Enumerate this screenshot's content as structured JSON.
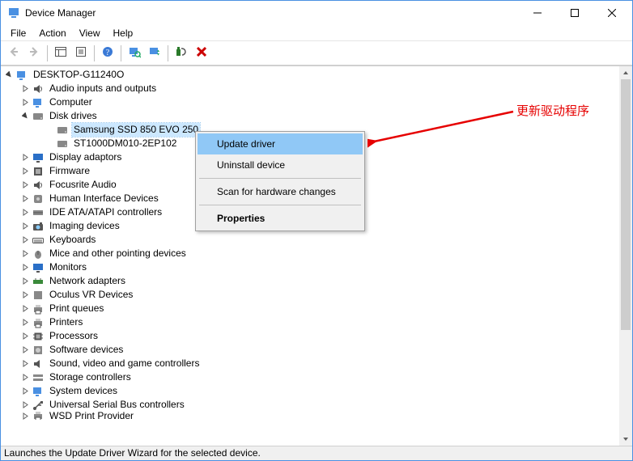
{
  "window": {
    "title": "Device Manager"
  },
  "menu": {
    "file": "File",
    "action": "Action",
    "view": "View",
    "help": "Help"
  },
  "tree": {
    "root": "DESKTOP-G11240O",
    "items": [
      {
        "label": "Audio inputs and outputs",
        "icon": "audio"
      },
      {
        "label": "Computer",
        "icon": "computer"
      },
      {
        "label": "Disk drives",
        "icon": "disk",
        "expanded": true
      },
      {
        "label": "Display adaptors",
        "icon": "display"
      },
      {
        "label": "Firmware",
        "icon": "firmware"
      },
      {
        "label": "Focusrite Audio",
        "icon": "audio"
      },
      {
        "label": "Human Interface Devices",
        "icon": "hid"
      },
      {
        "label": "IDE ATA/ATAPI controllers",
        "icon": "ide"
      },
      {
        "label": "Imaging devices",
        "icon": "imaging"
      },
      {
        "label": "Keyboards",
        "icon": "keyboard"
      },
      {
        "label": "Mice and other pointing devices",
        "icon": "mouse"
      },
      {
        "label": "Monitors",
        "icon": "monitor"
      },
      {
        "label": "Network adapters",
        "icon": "network"
      },
      {
        "label": "Oculus VR Devices",
        "icon": "generic"
      },
      {
        "label": "Print queues",
        "icon": "print"
      },
      {
        "label": "Printers",
        "icon": "print"
      },
      {
        "label": "Processors",
        "icon": "cpu"
      },
      {
        "label": "Software devices",
        "icon": "software"
      },
      {
        "label": "Sound, video and game controllers",
        "icon": "sound"
      },
      {
        "label": "Storage controllers",
        "icon": "storage"
      },
      {
        "label": "System devices",
        "icon": "system"
      },
      {
        "label": "Universal Serial Bus controllers",
        "icon": "usb"
      },
      {
        "label": "WSD Print Provider",
        "icon": "print"
      }
    ],
    "disks": [
      "Samsung SSD 850 EVO 250",
      "ST1000DM010-2EP102"
    ]
  },
  "context_menu": {
    "update": "Update driver",
    "uninstall": "Uninstall device",
    "scan": "Scan for hardware changes",
    "properties": "Properties"
  },
  "status": "Launches the Update Driver Wizard for the selected device.",
  "annotation": "更新驱动程序"
}
